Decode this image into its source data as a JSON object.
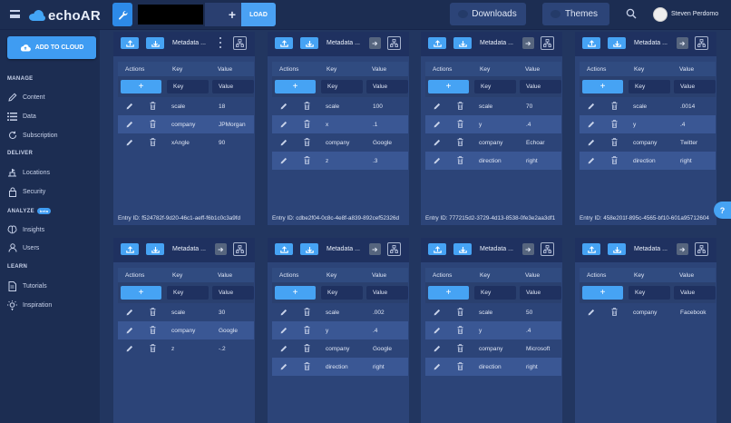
{
  "app": {
    "logo_text": "echoAR"
  },
  "topbar": {
    "load_label": "LOAD",
    "plus_label": "+",
    "downloads_label": "Downloads",
    "themes_label": "Themes",
    "user_name": "Steven Perdomo"
  },
  "sidebar": {
    "add_cloud_label": "ADD TO CLOUD",
    "sections": {
      "manage": "MANAGE",
      "deliver": "DELIVER",
      "analyze": "ANALYZE",
      "analyze_badge": "beta",
      "learn": "LEARN"
    },
    "items": {
      "content": "Content",
      "data": "Data",
      "subscription": "Subscription",
      "locations": "Locations",
      "security": "Security",
      "insights": "Insights",
      "users": "Users",
      "tutorials": "Tutorials",
      "inspiration": "Inspiration"
    }
  },
  "table_labels": {
    "actions": "Actions",
    "key": "Key",
    "value": "Value",
    "key_placeholder": "Key",
    "value_placeholder": "Value",
    "add": "+",
    "metadata": "Metadata ..."
  },
  "cards": [
    {
      "rows": [
        [
          "scale",
          "18"
        ],
        [
          "company",
          "JPMorgan"
        ],
        [
          "xAngle",
          "90"
        ]
      ],
      "entry_id": "Entry ID: f524782f-9d20-46c1-aeff-f6b1c0c3a9fd"
    },
    {
      "rows": [
        [
          "scale",
          "100"
        ],
        [
          "x",
          ".1"
        ],
        [
          "company",
          "Google"
        ],
        [
          "z",
          ".3"
        ]
      ],
      "entry_id": "Entry ID: cdbe2f04-0c8c-4e8f-a839-892cef52326d"
    },
    {
      "rows": [
        [
          "scale",
          "70"
        ],
        [
          "y",
          ".4"
        ],
        [
          "company",
          "Echoar"
        ],
        [
          "direction",
          "right"
        ]
      ],
      "entry_id": "Entry ID: 777215d2-3729-4d13-8538-0fe3e2aa3df1"
    },
    {
      "rows": [
        [
          "scale",
          ".0014"
        ],
        [
          "y",
          ".4"
        ],
        [
          "company",
          "Twitter"
        ],
        [
          "direction",
          "right"
        ]
      ],
      "entry_id": "Entry ID: 458e201f-895c-4565-bf10-601a95712604"
    },
    {
      "rows": [
        [
          "scale",
          "30"
        ],
        [
          "company",
          "Google"
        ],
        [
          "z",
          "-.2"
        ]
      ],
      "entry_id": ""
    },
    {
      "rows": [
        [
          "scale",
          ".002"
        ],
        [
          "y",
          ".4"
        ],
        [
          "company",
          "Google"
        ],
        [
          "direction",
          "right"
        ]
      ],
      "entry_id": ""
    },
    {
      "rows": [
        [
          "scale",
          "50"
        ],
        [
          "y",
          ".4"
        ],
        [
          "company",
          "Microsoft"
        ],
        [
          "direction",
          "right"
        ]
      ],
      "entry_id": ""
    },
    {
      "rows": [
        [
          "company",
          "Facebook"
        ]
      ],
      "entry_id": ""
    }
  ],
  "help_label": "?"
}
